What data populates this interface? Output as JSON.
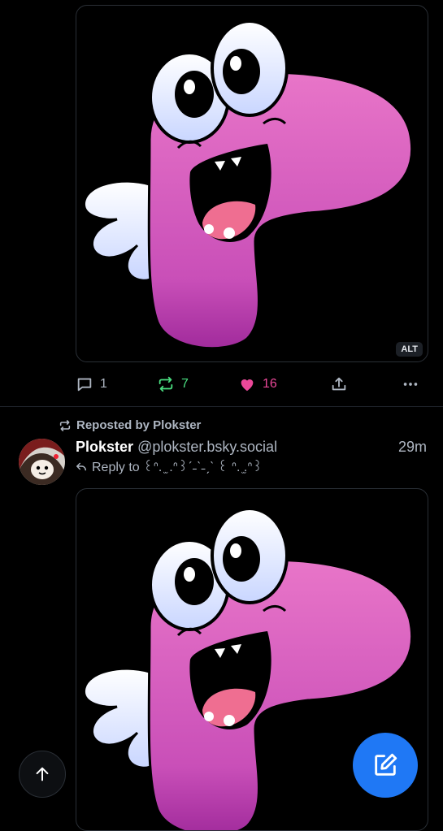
{
  "post1": {
    "image_alt_badge": "ALT",
    "reply_count": "1",
    "repost_count": "7",
    "like_count": "16",
    "colors": {
      "repost": "#4ade80",
      "like": "#ec4899",
      "muted": "#aeb6c2"
    },
    "icons": [
      "reply-icon",
      "repost-icon",
      "heart-icon",
      "share-icon",
      "more-icon"
    ]
  },
  "post2": {
    "repost_label": "Reposted by Plokster",
    "author_name": "Plokster",
    "author_handle": "@plokster.bsky.social",
    "time": "29m",
    "reply_to": "Reply to ꒰ᐢ. ̫ .ᐢ꒱ˊ˗ˋ˗ˏˋ ꒰ ᐢ. ̫.ᐢ꒱"
  },
  "fab": {
    "scroll_top_icon": "arrow-up-icon",
    "compose_icon": "compose-icon",
    "compose_color": "#1f78f5"
  }
}
